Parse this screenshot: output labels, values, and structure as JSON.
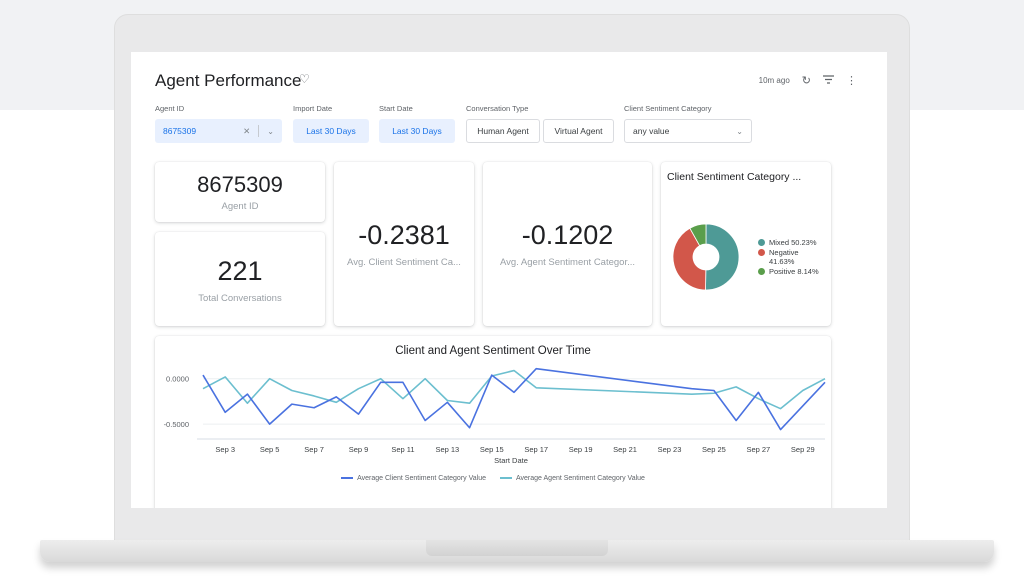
{
  "header": {
    "title": "Agent Performance",
    "last_updated": "10m ago"
  },
  "filters": {
    "agent_id": {
      "label": "Agent ID",
      "value": "8675309"
    },
    "import_date": {
      "label": "Import Date",
      "value": "Last 30 Days"
    },
    "start_date": {
      "label": "Start Date",
      "value": "Last 30 Days"
    },
    "conversation_type": {
      "label": "Conversation Type",
      "options": [
        "Human Agent",
        "Virtual Agent"
      ]
    },
    "client_sentiment": {
      "label": "Client Sentiment Category",
      "value": "any value"
    }
  },
  "kpis": {
    "agent_id": {
      "value": "8675309",
      "label": "Agent ID"
    },
    "total_conversations": {
      "value": "221",
      "label": "Total Conversations"
    },
    "avg_client_sentiment": {
      "value": "-0.2381",
      "label": "Avg. Client Sentiment Ca..."
    },
    "avg_agent_sentiment": {
      "value": "-0.1202",
      "label": "Avg. Agent Sentiment Categor..."
    }
  },
  "colors": {
    "accent": "#1a73e8",
    "client_line": "#4a72e0",
    "agent_line": "#6cbfcf",
    "mixed": "#4e9a96",
    "negative": "#d2574a",
    "positive": "#5a9e4b"
  },
  "chart_data": [
    {
      "type": "pie",
      "title": "Client Sentiment Category ...",
      "donut": true,
      "legend_position": "right",
      "slices": [
        {
          "name": "Mixed",
          "value": 50.23,
          "label": "Mixed 50.23%",
          "color": "#4e9a96"
        },
        {
          "name": "Negative",
          "value": 41.63,
          "label_line1": "Negative",
          "label_line2": "41.63%",
          "color": "#d2574a"
        },
        {
          "name": "Positive",
          "value": 8.14,
          "label": "Positive 8.14%",
          "color": "#5a9e4b"
        }
      ]
    },
    {
      "type": "line",
      "title": "Client and Agent Sentiment Over Time",
      "xlabel": "Start Date",
      "ylabel": "",
      "ylim": [
        -0.62,
        0.14
      ],
      "yticks": [
        0.0,
        -0.5
      ],
      "ytick_labels": [
        "0.0000",
        "-0.5000"
      ],
      "xlim": [
        2,
        30
      ],
      "xticks": [
        3,
        5,
        7,
        9,
        11,
        13,
        15,
        17,
        19,
        21,
        23,
        25,
        27,
        29
      ],
      "xtick_labels": [
        "Sep 3",
        "Sep 5",
        "Sep 7",
        "Sep 9",
        "Sep 11",
        "Sep 13",
        "Sep 15",
        "Sep 17",
        "Sep 19",
        "Sep 21",
        "Sep 23",
        "Sep 25",
        "Sep 27",
        "Sep 29"
      ],
      "grid": true,
      "legend_position": "bottom",
      "series": [
        {
          "name": "Average Client Sentiment Category Value",
          "color": "#4a72e0",
          "x": [
            2,
            3,
            4,
            5,
            6,
            7,
            8,
            9,
            10,
            11,
            12,
            13,
            14,
            15,
            16,
            17,
            24,
            25,
            26,
            27,
            28,
            30
          ],
          "y": [
            0.04,
            -0.37,
            -0.17,
            -0.5,
            -0.28,
            -0.32,
            -0.2,
            -0.39,
            -0.04,
            -0.04,
            -0.46,
            -0.26,
            -0.54,
            0.04,
            -0.15,
            0.11,
            -0.11,
            -0.13,
            -0.46,
            -0.15,
            -0.56,
            -0.04
          ]
        },
        {
          "name": "Average Agent Sentiment Category Value",
          "color": "#6cbfcf",
          "x": [
            2,
            3,
            4,
            5,
            6,
            7,
            8,
            9,
            10,
            11,
            12,
            13,
            14,
            15,
            16,
            17,
            24,
            25,
            26,
            27,
            28,
            29,
            30
          ],
          "y": [
            -0.11,
            0.02,
            -0.27,
            0.0,
            -0.13,
            -0.19,
            -0.26,
            -0.11,
            0.0,
            -0.22,
            0.0,
            -0.24,
            -0.27,
            0.03,
            0.09,
            -0.1,
            -0.17,
            -0.16,
            -0.09,
            -0.22,
            -0.33,
            -0.13,
            0.0
          ]
        }
      ]
    }
  ]
}
